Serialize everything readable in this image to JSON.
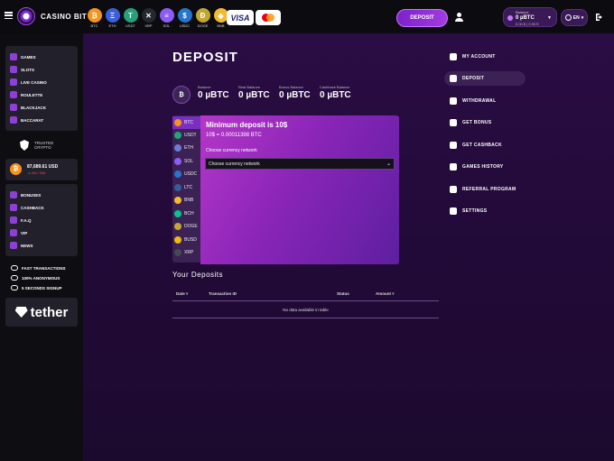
{
  "brand": {
    "name": "CASINO BIT"
  },
  "header": {
    "coins": [
      {
        "symbol": "₿",
        "label": "BTC",
        "color": "#f7931a"
      },
      {
        "symbol": "Ξ",
        "label": "ETH",
        "color": "#3c5fd8"
      },
      {
        "symbol": "T",
        "label": "USDT",
        "color": "#26a17b"
      },
      {
        "symbol": "✕",
        "label": "XRP",
        "color": "#23292f"
      },
      {
        "symbol": "≡",
        "label": "SOL",
        "color": "#8b5cf6"
      },
      {
        "symbol": "$",
        "label": "USDC",
        "color": "#2775ca"
      },
      {
        "symbol": "Ð",
        "label": "DOGE",
        "color": "#c2a633"
      },
      {
        "symbol": "◆",
        "label": "BNB",
        "color": "#f3ba2f"
      }
    ],
    "visa_label": "VISA",
    "deposit_label": "DEPOSIT",
    "balance": {
      "title": "Balance",
      "value": "0 µBTC",
      "sub": "0.00 ₤ | 0.00 €"
    },
    "language": "EN"
  },
  "sidebar": {
    "games": [
      {
        "label": "GAMES"
      },
      {
        "label": "SLOTS"
      },
      {
        "label": "LIVE CASINO"
      },
      {
        "label": "ROULETTE"
      },
      {
        "label": "BLACKJACK"
      },
      {
        "label": "BACCARAT"
      }
    ],
    "trusted_line1": "TRUSTED",
    "trusted_line2": "CRYPTO",
    "btc_balance": {
      "value": "87,689.61 USD",
      "change": "-1.4% / 24h"
    },
    "links": [
      {
        "label": "BONUSES"
      },
      {
        "label": "CASHBACK"
      },
      {
        "label": "F.A.Q"
      },
      {
        "label": "VIP"
      },
      {
        "label": "NEWS"
      }
    ],
    "features": [
      {
        "label": "FAST TRANSACTIONS"
      },
      {
        "label": "100% ANONYMOUS"
      },
      {
        "label": "5 SECONDS SIGNUP"
      }
    ],
    "tether_label": "tether"
  },
  "main": {
    "title": "DEPOSIT",
    "balance_coin": "₿",
    "balances": [
      {
        "label": "Balance",
        "value": "0 µBTC"
      },
      {
        "label": "Real Balance",
        "value": "0 µBTC"
      },
      {
        "label": "Bonus Balance",
        "value": "0 µBTC"
      },
      {
        "label": "Cashback Balance",
        "value": "0 µBTC"
      }
    ],
    "currencies": [
      {
        "label": "BTC",
        "color": "#f7931a"
      },
      {
        "label": "USDT",
        "color": "#26a17b"
      },
      {
        "label": "ETH",
        "color": "#6b7bd8"
      },
      {
        "label": "SOL",
        "color": "#8b5cf6"
      },
      {
        "label": "USDC",
        "color": "#2775ca"
      },
      {
        "label": "LTC",
        "color": "#345d9d"
      },
      {
        "label": "BNB",
        "color": "#f3ba2f"
      },
      {
        "label": "BCH",
        "color": "#0ac18e"
      },
      {
        "label": "DOGE",
        "color": "#c2a633"
      },
      {
        "label": "BUSD",
        "color": "#f0b90b"
      },
      {
        "label": "XRP",
        "color": "#444a55"
      }
    ],
    "deposit": {
      "title": "Minimum deposit is 10$",
      "conversion": "10$ = 0.00011398 BTC",
      "network_label": "Choose currency network",
      "network_value": "Choose currency network"
    },
    "your_deposits_title": "Your Deposits",
    "table": {
      "headers": [
        "Date",
        "Transaction ID",
        "Status",
        "Amount"
      ],
      "empty": "No data available in table"
    }
  },
  "account_menu": [
    {
      "label": "MY ACCOUNT"
    },
    {
      "label": "DEPOSIT"
    },
    {
      "label": "WITHDRAWAL"
    },
    {
      "label": "GET BONUS"
    },
    {
      "label": "GET CASHBACK"
    },
    {
      "label": "GAMES HISTORY"
    },
    {
      "label": "REFERRAL PROGRAM"
    },
    {
      "label": "SETTINGS"
    }
  ]
}
